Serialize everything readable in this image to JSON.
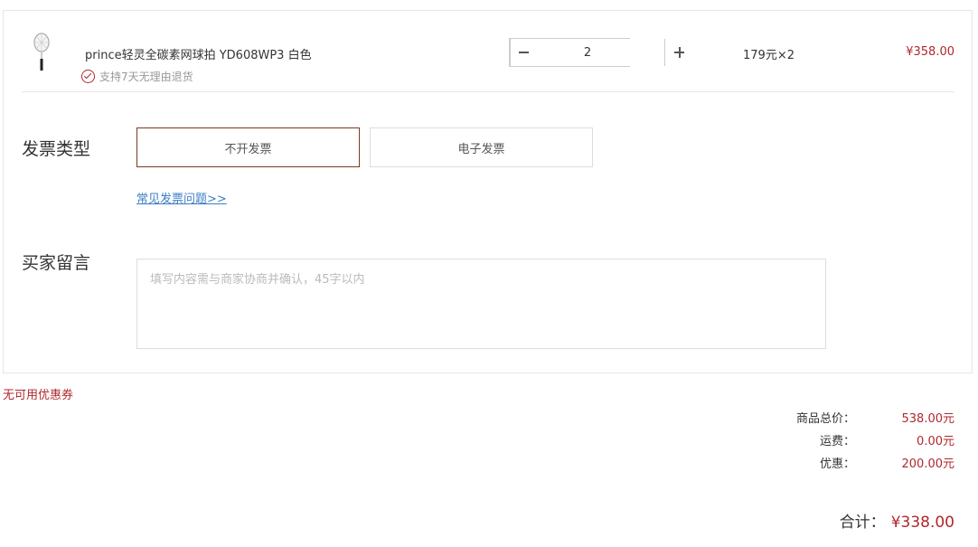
{
  "item": {
    "name": "prince轻灵全碳素网球拍 YD608WP3 白色",
    "return_policy": "支持7天无理由退货",
    "quantity": "2",
    "unit_price": "179元×2",
    "line_total": "¥358.00",
    "thumb_icon": "tennis-racket-icon"
  },
  "invoice": {
    "label": "发票类型",
    "options": [
      "不开发票",
      "电子发票"
    ],
    "selected": "不开发票",
    "faq_link": "常见发票问题>>"
  },
  "message": {
    "label": "买家留言",
    "placeholder": "填写内容需与商家协商并确认，45字以内"
  },
  "coupon": {
    "text": "无可用优惠券"
  },
  "summary": {
    "rows": [
      {
        "label": "商品总价：",
        "value": "538.00元"
      },
      {
        "label": "运费：",
        "value": "0.00元"
      },
      {
        "label": "优惠：",
        "value": "200.00元"
      }
    ],
    "total_label": "合计：",
    "total_value": "¥338.00"
  },
  "colors": {
    "accent": "#b0282d",
    "selected_border": "#7a3a1e",
    "link": "#3d7fc5"
  }
}
